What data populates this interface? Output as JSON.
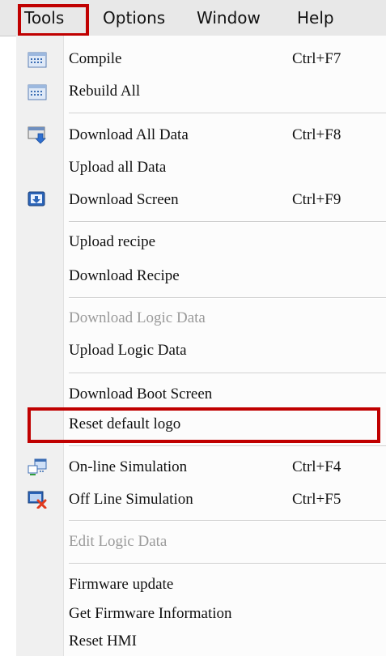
{
  "menubar": {
    "items": [
      "Tools",
      "Options",
      "Window",
      "Help"
    ]
  },
  "tools_menu": {
    "compile": {
      "label": "Compile",
      "shortcut": "Ctrl+F7"
    },
    "rebuild_all": {
      "label": "Rebuild All"
    },
    "download_all_data": {
      "label": "Download All Data",
      "shortcut": "Ctrl+F8"
    },
    "upload_all_data": {
      "label": "Upload all Data"
    },
    "download_screen": {
      "label": "Download Screen",
      "shortcut": "Ctrl+F9"
    },
    "upload_recipe": {
      "label": "Upload recipe"
    },
    "download_recipe": {
      "label": "Download Recipe"
    },
    "download_logic_data": {
      "label": "Download Logic Data",
      "disabled": true
    },
    "upload_logic_data": {
      "label": "Upload Logic Data"
    },
    "download_boot_screen": {
      "label": "Download Boot Screen"
    },
    "reset_default_logo": {
      "label": "Reset default logo",
      "highlighted": true
    },
    "online_simulation": {
      "label": "On-line Simulation",
      "shortcut": "Ctrl+F4"
    },
    "offline_simulation": {
      "label": "Off Line Simulation",
      "shortcut": "Ctrl+F5"
    },
    "edit_logic_data": {
      "label": "Edit Logic Data",
      "disabled": true
    },
    "firmware_update": {
      "label": "Firmware update"
    },
    "get_firmware_information": {
      "label": "Get Firmware Information"
    },
    "reset_hmi": {
      "label": "Reset HMI"
    }
  },
  "colors": {
    "annotation": "#c00000",
    "disabled_text": "#9a9a9a",
    "gutter": "#f0f0f0"
  }
}
